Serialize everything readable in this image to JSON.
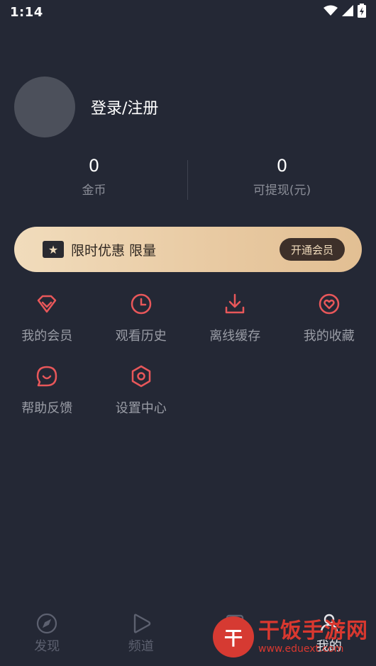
{
  "status_bar": {
    "time": "1:14"
  },
  "profile": {
    "login_label": "登录/注册"
  },
  "stats": [
    {
      "value": "0",
      "label": "金币"
    },
    {
      "value": "0",
      "label": "可提现(元)"
    }
  ],
  "vip_banner": {
    "text": "限时优惠 限量",
    "button_label": "开通会员"
  },
  "menu": [
    {
      "label": "我的会员",
      "icon": "diamond-icon"
    },
    {
      "label": "观看历史",
      "icon": "clock-icon"
    },
    {
      "label": "离线缓存",
      "icon": "download-icon"
    },
    {
      "label": "我的收藏",
      "icon": "heart-icon"
    },
    {
      "label": "帮助反馈",
      "icon": "chat-smile-icon"
    },
    {
      "label": "设置中心",
      "icon": "hexagon-settings-icon"
    }
  ],
  "bottom_nav": [
    {
      "label": "发现",
      "icon": "compass-icon"
    },
    {
      "label": "频道",
      "icon": "play-icon"
    },
    {
      "label": "",
      "icon": "list-icon"
    },
    {
      "label": "我的",
      "icon": "person-icon"
    }
  ],
  "watermark": {
    "logo": "干",
    "title": "干饭手游网",
    "url": "www.eduext.com"
  },
  "colors": {
    "background": "#242835",
    "accent": "#e8575a",
    "vip_gold": "#e8c9a1"
  }
}
